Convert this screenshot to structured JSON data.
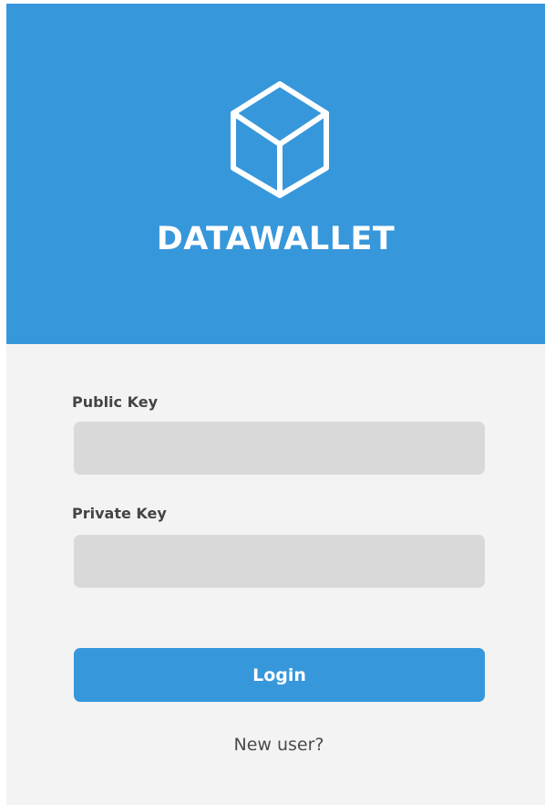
{
  "brand": {
    "name": "DATAWALLET",
    "logo_icon": "cube-icon",
    "color": "#3797db"
  },
  "form": {
    "public_key_label": "Public Key",
    "public_key_value": "",
    "public_key_placeholder": "",
    "private_key_label": "Private Key",
    "private_key_value": "",
    "private_key_placeholder": "",
    "login_label": "Login",
    "new_user_label": "New user?"
  }
}
